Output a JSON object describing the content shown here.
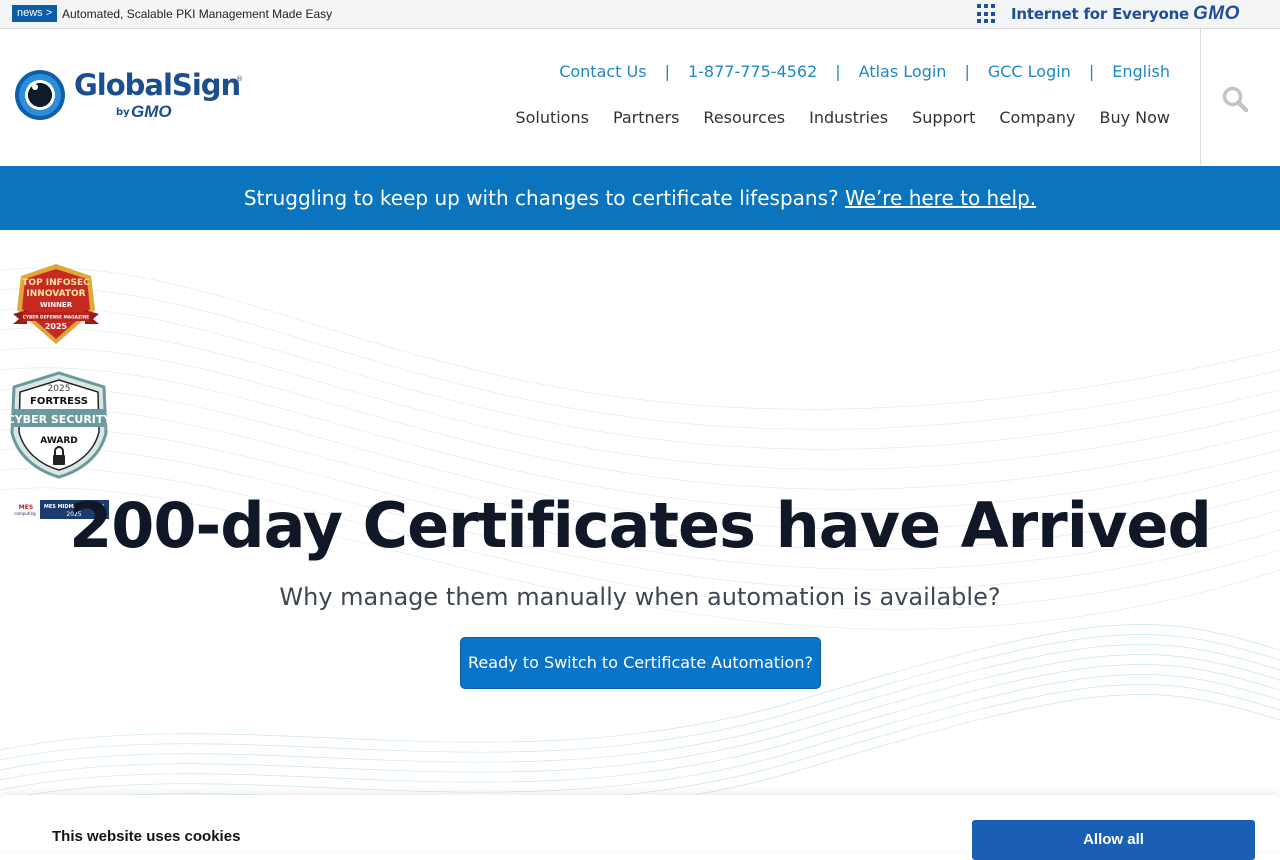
{
  "topbar": {
    "news_badge": "news >",
    "news_text": "Automated, Scalable PKI Management Made Easy",
    "tagline": "Internet for Everyone",
    "gmo_logo": "GMO"
  },
  "header": {
    "logo_text": "GlobalSign",
    "logo_reg": "®",
    "logo_by": "by",
    "logo_gmo": "GMO",
    "utility_links": [
      {
        "label": "Contact Us"
      },
      {
        "label": "1-877-775-4562"
      },
      {
        "label": "Atlas Login"
      },
      {
        "label": "GCC Login"
      },
      {
        "label": "English"
      }
    ],
    "separator": "|",
    "main_nav": [
      {
        "label": "Solutions"
      },
      {
        "label": "Partners"
      },
      {
        "label": "Resources"
      },
      {
        "label": "Industries"
      },
      {
        "label": "Support"
      },
      {
        "label": "Company"
      },
      {
        "label": "Buy Now"
      }
    ],
    "search_icon": "search-icon"
  },
  "announcement": {
    "text": "Struggling to keep up with changes to certificate lifespans?",
    "link": "We’re here to help."
  },
  "awards": {
    "award1": {
      "line1": "TOP INFOSEC",
      "line2": "INNOVATOR",
      "line3": "WINNER",
      "line4": "CYBER DEFENSE MAGAZINE",
      "year": "2025"
    },
    "award2": {
      "year": "2025",
      "line1": "FORTRESS",
      "line2": "CYBER SECURITY",
      "line3": "AWARD"
    },
    "award3": {
      "brand": "MES",
      "sub": "computing",
      "line1": "MES MIDMARKET 100",
      "year": "2025"
    }
  },
  "hero": {
    "title": "200-day Certificates have Arrived",
    "subtitle": "Why manage them manually when automation is available?",
    "cta": "Ready to Switch to Certificate Automation?"
  },
  "cookie": {
    "title": "This website uses cookies",
    "allow_all": "Allow all"
  },
  "colors": {
    "brand_blue": "#0a74bf",
    "link_blue": "#1e88c7",
    "logo_blue": "#1a4e8f",
    "gmo_blue": "#1f4e99",
    "title_dark": "#101828"
  }
}
